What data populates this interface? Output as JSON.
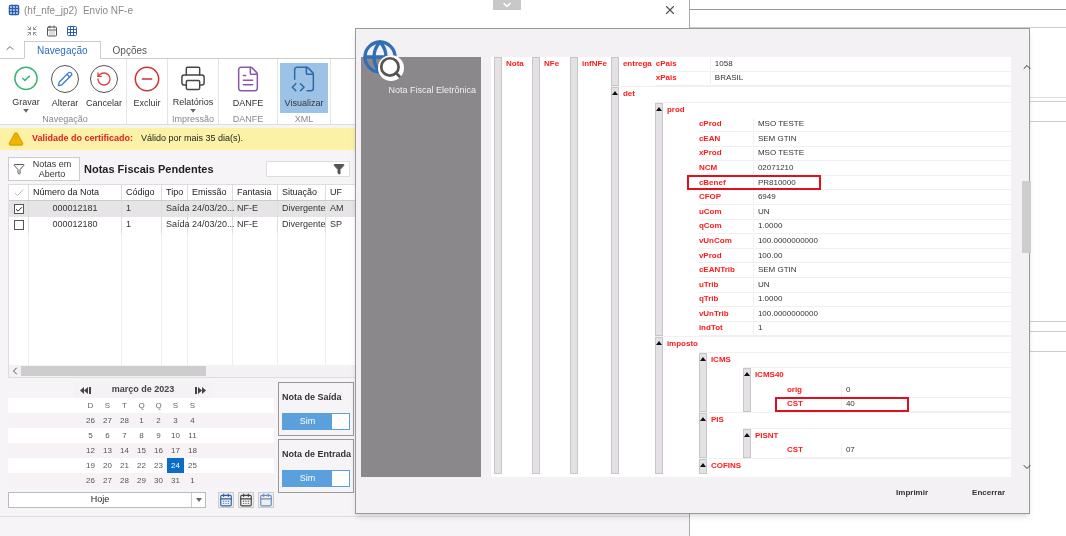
{
  "main_window": {
    "title": "(hf_nfe_jp2)  Envio NF-e",
    "ribbon_tabs": [
      {
        "label": "Navegação",
        "selected": true
      },
      {
        "label": "Opções",
        "selected": false
      }
    ],
    "ribbon_groups": [
      {
        "label": "Navegação",
        "buttons": [
          {
            "label": "Gravar",
            "dropdown": true,
            "selected": false
          },
          {
            "label": "Alterar",
            "dropdown": false,
            "selected": false
          },
          {
            "label": "Cancelar",
            "dropdown": false,
            "selected": false
          }
        ]
      },
      {
        "buttons": [
          {
            "label": "Excluir",
            "dropdown": false,
            "selected": false
          }
        ]
      },
      {
        "label": "Impressão",
        "buttons": [
          {
            "label": "Relatórios",
            "dropdown": true,
            "selected": false
          }
        ]
      },
      {
        "label": "DANFE",
        "buttons": [
          {
            "label": "DANFE",
            "dropdown": false,
            "selected": false
          }
        ]
      },
      {
        "label": "XML",
        "buttons": [
          {
            "label": "Visualizar",
            "dropdown": false,
            "selected": true
          }
        ]
      }
    ],
    "warning": {
      "label": "Validade do certificado:",
      "message": "Válido por mais 35 dia(s)."
    },
    "list": {
      "filter_button": "Notas em Aberto",
      "title": "Notas Fiscais Pendentes",
      "columns": [
        "Número da Nota",
        "Código",
        "Tipo",
        "Emissão",
        "Fantasia",
        "Situação",
        "UF"
      ],
      "rows": [
        {
          "checked": true,
          "selected": true,
          "cells": [
            "000012181",
            "1",
            "Saída",
            "24/03/20...",
            "NF-E",
            "Divergente",
            "AM"
          ]
        },
        {
          "checked": false,
          "selected": false,
          "cells": [
            "000012180",
            "1",
            "Saída",
            "24/03/20...",
            "NF-E",
            "Divergente",
            "SP"
          ]
        }
      ]
    },
    "calendar": {
      "month": "março de 2023",
      "weekdays": [
        "D",
        "S",
        "T",
        "Q",
        "Q",
        "S",
        "S"
      ],
      "weeks": [
        [
          {
            "day": "26",
            "selected": false
          },
          {
            "day": "27",
            "selected": false
          },
          {
            "day": "28",
            "selected": false
          },
          {
            "day": "1",
            "selected": false
          },
          {
            "day": "2",
            "selected": false
          },
          {
            "day": "3",
            "selected": false
          },
          {
            "day": "4",
            "selected": false
          }
        ],
        [
          {
            "day": "5",
            "selected": false
          },
          {
            "day": "6",
            "selected": false
          },
          {
            "day": "7",
            "selected": false
          },
          {
            "day": "8",
            "selected": false
          },
          {
            "day": "9",
            "selected": false
          },
          {
            "day": "10",
            "selected": false
          },
          {
            "day": "11",
            "selected": false
          }
        ],
        [
          {
            "day": "12",
            "selected": false
          },
          {
            "day": "13",
            "selected": false
          },
          {
            "day": "14",
            "selected": false
          },
          {
            "day": "15",
            "selected": false
          },
          {
            "day": "16",
            "selected": false
          },
          {
            "day": "17",
            "selected": false
          },
          {
            "day": "18",
            "selected": false
          }
        ],
        [
          {
            "day": "19",
            "selected": false
          },
          {
            "day": "20",
            "selected": false
          },
          {
            "day": "21",
            "selected": false
          },
          {
            "day": "22",
            "selected": false
          },
          {
            "day": "23",
            "selected": false
          },
          {
            "day": "24",
            "selected": true
          },
          {
            "day": "25",
            "selected": false
          }
        ],
        [
          {
            "day": "26",
            "selected": false
          },
          {
            "day": "27",
            "selected": false
          },
          {
            "day": "28",
            "selected": false
          },
          {
            "day": "29",
            "selected": false
          },
          {
            "day": "30",
            "selected": false
          },
          {
            "day": "31",
            "selected": false
          },
          {
            "day": "1",
            "selected": false
          }
        ]
      ]
    },
    "date_field": {
      "value": "Hoje"
    },
    "panels": [
      {
        "title": "Nota de Saída",
        "toggle": {
          "label": "Sim",
          "on": true
        }
      },
      {
        "title": "Nota de Entrada",
        "toggle": {
          "label": "Sim",
          "on": true
        }
      }
    ]
  },
  "dialog": {
    "logo_caption": "Nota Fiscal Eletrônica",
    "tree": [
      {
        "tag": "Nota",
        "children": [
          {
            "tag": "NFe",
            "children": [
              {
                "tag": "infNFe",
                "children": [
                  {
                    "tag": "entrega",
                    "children": [
                      {
                        "tag": "cPais",
                        "value": "1058"
                      },
                      {
                        "tag": "xPais",
                        "value": "BRASIL"
                      }
                    ]
                  },
                  {
                    "tag": "det",
                    "expanded": true,
                    "children": [
                      {
                        "tag": "prod",
                        "expanded": true,
                        "children": [
                          {
                            "tag": "cProd",
                            "value": "MSO TESTE"
                          },
                          {
                            "tag": "cEAN",
                            "value": "SEM GTIN"
                          },
                          {
                            "tag": "xProd",
                            "value": "MSO TESTE"
                          },
                          {
                            "tag": "NCM",
                            "value": "02071210"
                          },
                          {
                            "tag": "cBenef",
                            "value": "PR810000",
                            "highlighted": true
                          },
                          {
                            "tag": "CFOP",
                            "value": "6949"
                          },
                          {
                            "tag": "uCom",
                            "value": "UN"
                          },
                          {
                            "tag": "qCom",
                            "value": "1.0000"
                          },
                          {
                            "tag": "vUnCom",
                            "value": "100.0000000000"
                          },
                          {
                            "tag": "vProd",
                            "value": "100.00"
                          },
                          {
                            "tag": "cEANTrib",
                            "value": "SEM GTIN"
                          },
                          {
                            "tag": "uTrib",
                            "value": "UN"
                          },
                          {
                            "tag": "qTrib",
                            "value": "1.0000"
                          },
                          {
                            "tag": "vUnTrib",
                            "value": "100.0000000000"
                          },
                          {
                            "tag": "indTot",
                            "value": "1"
                          }
                        ]
                      },
                      {
                        "tag": "imposto",
                        "expanded": true,
                        "children": [
                          {
                            "tag": "ICMS",
                            "expanded": true,
                            "children": [
                              {
                                "tag": "ICMS40",
                                "expanded": true,
                                "children": [
                                  {
                                    "tag": "orig",
                                    "value": "0"
                                  },
                                  {
                                    "tag": "CST",
                                    "value": "40",
                                    "highlighted": true
                                  }
                                ]
                              }
                            ]
                          },
                          {
                            "tag": "PIS",
                            "expanded": true,
                            "children": [
                              {
                                "tag": "PISNT",
                                "expanded": true,
                                "children": [
                                  {
                                    "tag": "CST",
                                    "value": "07"
                                  }
                                ]
                              }
                            ]
                          },
                          {
                            "tag": "COFINS",
                            "expanded": true
                          }
                        ]
                      }
                    ]
                  }
                ]
              }
            ]
          }
        ]
      }
    ],
    "buttons": [
      "Imprimir",
      "Encerrar"
    ]
  }
}
